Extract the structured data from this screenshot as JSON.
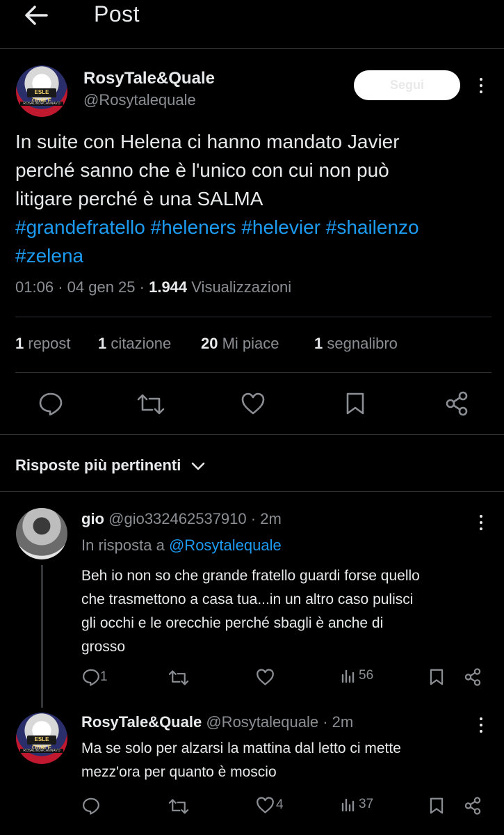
{
  "header": {
    "title": "Post",
    "back_icon": "arrow-left-icon"
  },
  "post": {
    "author_name": "RosyTale&Quale",
    "author_handle": "@Rosytalequale",
    "avatar_badge": "ESLE QUALE",
    "avatar_strip": "ROSALINDACANNAVO",
    "follow_label": "Segui",
    "text_lines": [
      "In suite con Helena ci hanno mandato Javier",
      "perché sanno che è l'unico con cui non può",
      "litigare perché è una SALMA"
    ],
    "hashtags_line1": "#grandefratello #heleners #helevier #shailenzo",
    "hashtags_line2": "#zelena",
    "time": "01:06",
    "date": "04 gen 25",
    "sep": "·",
    "views_count": "1.944",
    "views_label": "Visualizzazioni",
    "stats": [
      {
        "count": "1",
        "label": "repost"
      },
      {
        "count": "1",
        "label": "citazione"
      },
      {
        "count": "20",
        "label": "Mi piace"
      },
      {
        "count": "1",
        "label": "segnalibro"
      }
    ]
  },
  "replies_section": {
    "title": "Risposte più pertinenti"
  },
  "replies": [
    {
      "name": "gio",
      "handle": "@gio332462537910",
      "time": "· 2m",
      "reply_to_prefix": "In risposta a",
      "reply_to_handle": "@Rosytalequale",
      "text_lines": [
        "Beh io non so che grande fratello guardi forse quello",
        "che trasmettono a casa tua...in un altro caso pulisci",
        "gli occhi e le orecchie perché sbagli  è anche di",
        "grosso"
      ],
      "reply_count": "1",
      "repost_count": "",
      "like_count": "",
      "views": "56"
    },
    {
      "name": "RosyTale&Quale",
      "handle": "@Rosytalequale",
      "time": "· 2m",
      "text_lines": [
        "Ma se solo per alzarsi la mattina dal letto ci mette",
        "mezz'ora per quanto è moscio"
      ],
      "reply_count": "",
      "repost_count": "",
      "like_count": "4",
      "views": "37"
    }
  ],
  "colors": {
    "background": "#000000",
    "text": "#e7e9ea",
    "muted": "#8b8f94",
    "accent": "#1d9bf0",
    "divider": "#2f3336"
  }
}
